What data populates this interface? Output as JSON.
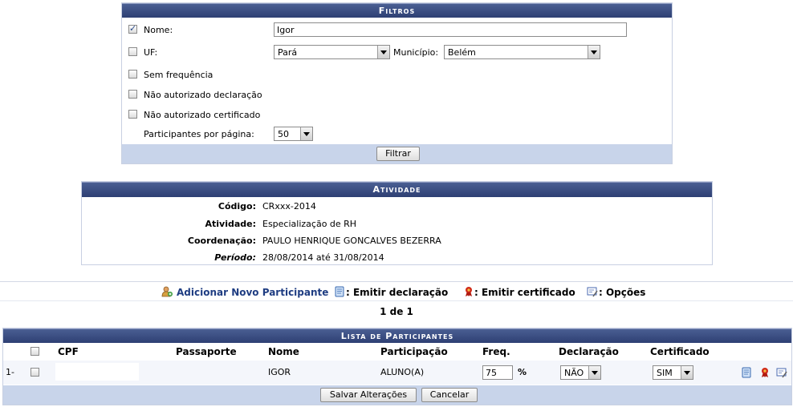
{
  "filtros": {
    "title": "Filtros",
    "nome": {
      "label": "Nome:",
      "value": "Igor",
      "checked": true
    },
    "uf": {
      "label": "UF:",
      "value": "Pará",
      "checked": false
    },
    "municipio": {
      "label": "Município:",
      "value": "Belém"
    },
    "sem_frequencia": {
      "label": "Sem frequência",
      "checked": false
    },
    "nao_aut_declaracao": {
      "label": "Não autorizado declaração",
      "checked": false
    },
    "nao_aut_certificado": {
      "label": "Não autorizado certificado",
      "checked": false
    },
    "por_pagina": {
      "label": "Participantes por página:",
      "value": "50"
    },
    "filtrar_label": "Filtrar"
  },
  "atividade": {
    "title": "Atividade",
    "codigo": {
      "label": "Código:",
      "value": "CRxxx-2014"
    },
    "atividade": {
      "label": "Atividade:",
      "value": "Especialização de RH"
    },
    "coordenacao": {
      "label": "Coordenação:",
      "value": "PAULO HENRIQUE GONCALVES BEZERRA"
    },
    "periodo": {
      "label": "Período:",
      "value": "28/08/2014 até 31/08/2014"
    }
  },
  "actions": {
    "adicionar": "Adicionar Novo Participante",
    "emitir_declaracao": ": Emitir declaração",
    "emitir_certificado": ": Emitir certificado",
    "opcoes": ": Opções"
  },
  "pager": "1 de 1",
  "lista": {
    "title": "Lista de Participantes",
    "headers": {
      "cpf": "CPF",
      "passaporte": "Passaporte",
      "nome": "Nome",
      "participacao": "Participação",
      "freq": "Freq.",
      "declaracao": "Declaração",
      "certificado": "Certificado"
    },
    "rows": [
      {
        "index": "1-",
        "cpf": "",
        "passaporte": "",
        "nome": "IGOR",
        "participacao": "ALUNO(A)",
        "freq": "75",
        "freq_unit": "%",
        "declaracao": "NÃO",
        "certificado": "SIM"
      }
    ],
    "salvar_label": "Salvar Alterações",
    "cancelar_label": "Cancelar"
  },
  "colors": {
    "caption": "#2e3f73",
    "footer": "#c8d4ea",
    "link": "#1f3d82"
  }
}
